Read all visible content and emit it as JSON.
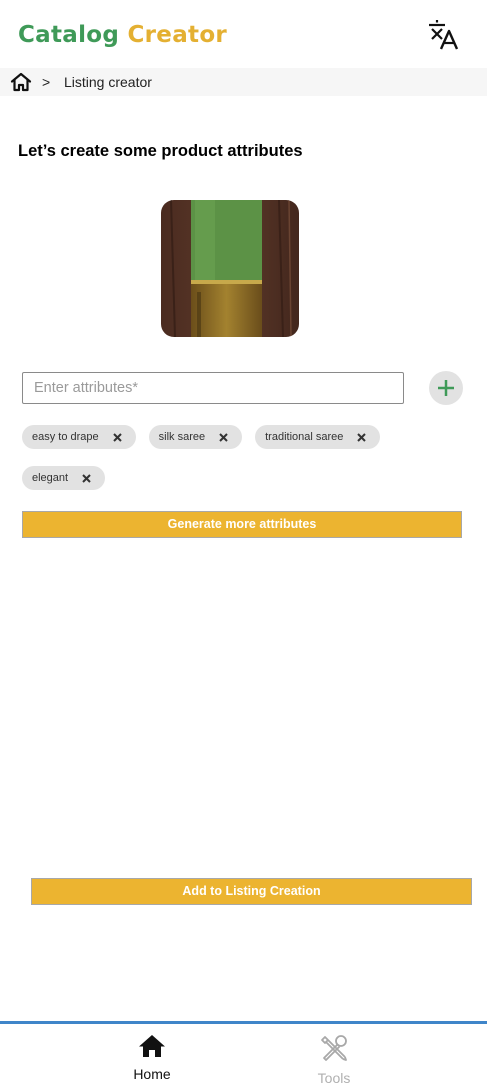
{
  "header": {
    "logo_word1": "Catalog",
    "logo_word2": "Creator",
    "translate_icon": "translate-icon",
    "colors": {
      "logo_green": "#3f9a58",
      "logo_gold": "#e4b032"
    }
  },
  "breadcrumb": {
    "home_icon": "home-outline-icon",
    "separator": ">",
    "current": "Listing creator"
  },
  "main": {
    "title": "Let’s create some product attributes",
    "attribute_input": {
      "placeholder": "Enter attributes*",
      "value": ""
    },
    "add_attribute_icon": "plus-icon",
    "attributes": [
      {
        "label": "easy to drape"
      },
      {
        "label": "silk saree"
      },
      {
        "label": "traditional saree"
      },
      {
        "label": "elegant"
      }
    ],
    "generate_button": "Generate more attributes",
    "add_button": "Add to Listing Creation",
    "colors": {
      "accent": "#ecb430",
      "plus_green": "#3f9a58"
    }
  },
  "bottom_nav": {
    "items": [
      {
        "label": "Home",
        "icon": "home-icon",
        "active": true
      },
      {
        "label": "Tools",
        "icon": "tools-icon",
        "active": false
      }
    ],
    "colors": {
      "top_border": "#3f85c9",
      "inactive": "#b0b0b0"
    }
  }
}
